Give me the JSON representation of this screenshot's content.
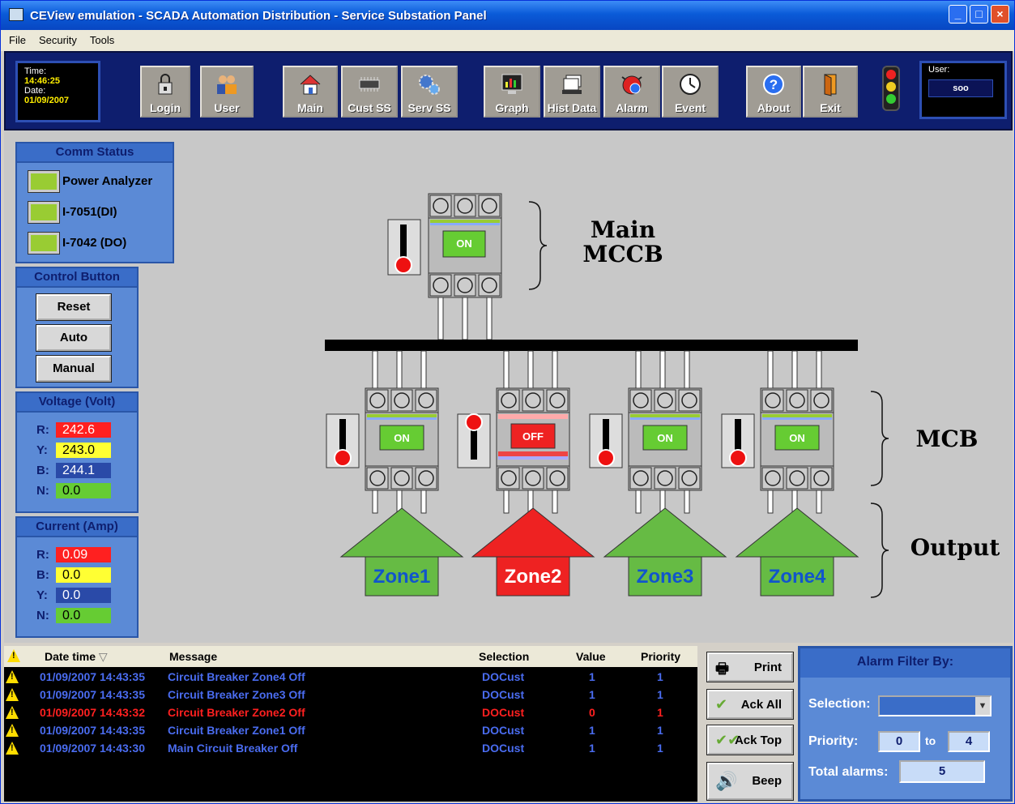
{
  "window": {
    "title": "CEView emulation - SCADA Automation Distribution - Service Substation Panel"
  },
  "menu": [
    "File",
    "Security",
    "Tools"
  ],
  "clock": {
    "time_label": "Time:",
    "time": "14:46:25",
    "date_label": "Date:",
    "date": "01/09/2007"
  },
  "toolbar": {
    "buttons": [
      "Login",
      "User",
      "Main",
      "Cust SS",
      "Serv SS",
      "Graph",
      "Hist Data",
      "Alarm",
      "Event",
      "About",
      "Exit"
    ]
  },
  "user": {
    "label": "User:",
    "value": "soo"
  },
  "comm_status": {
    "title": "Comm Status",
    "items": [
      "Power Analyzer",
      "I-7051(DI)",
      "I-7042 (DO)"
    ],
    "led_color": "#99cc33"
  },
  "control": {
    "title": "Control Button",
    "buttons": [
      "Reset",
      "Auto",
      "Manual"
    ]
  },
  "voltage": {
    "title": "Voltage (Volt)",
    "rows": [
      {
        "k": "R:",
        "v": "242.6",
        "color": "#ff2020",
        "text": "#ffffff"
      },
      {
        "k": "Y:",
        "v": "243.0",
        "color": "#ffff33",
        "text": "#000000"
      },
      {
        "k": "B:",
        "v": "244.1",
        "color": "#2a4aa8",
        "text": "#ffffff"
      },
      {
        "k": "N:",
        "v": "0.0",
        "color": "#66cc33",
        "text": "#000000"
      }
    ]
  },
  "current": {
    "title": "Current (Amp)",
    "rows": [
      {
        "k": "R:",
        "v": "0.09",
        "color": "#ff2020",
        "text": "#ffffff"
      },
      {
        "k": "B:",
        "v": "0.0",
        "color": "#ffff33",
        "text": "#000000"
      },
      {
        "k": "Y:",
        "v": "0.0",
        "color": "#2a4aa8",
        "text": "#ffffff"
      },
      {
        "k": "N:",
        "v": "0.0",
        "color": "#66cc33",
        "text": "#000000"
      }
    ]
  },
  "diagram": {
    "main_label_1": "Main",
    "main_label_2": "MCCB",
    "main_breaker_state": "ON",
    "mcb_label": "MCB",
    "output_label": "Output",
    "zones": [
      {
        "name": "Zone1",
        "state": "ON",
        "color": "#66bb44"
      },
      {
        "name": "Zone2",
        "state": "OFF",
        "color": "#ee2222"
      },
      {
        "name": "Zone3",
        "state": "ON",
        "color": "#66bb44"
      },
      {
        "name": "Zone4",
        "state": "ON",
        "color": "#66bb44"
      }
    ]
  },
  "alarm_log": {
    "headers": {
      "datetime": "Date time",
      "message": "Message",
      "selection": "Selection",
      "value": "Value",
      "priority": "Priority"
    },
    "rows": [
      {
        "datetime": "01/09/2007 14:43:35",
        "message": "Circuit Breaker Zone4 Off",
        "selection": "DOCust",
        "value": "1",
        "priority": "1",
        "color": "#4a6cf0"
      },
      {
        "datetime": "01/09/2007 14:43:35",
        "message": "Circuit Breaker Zone3 Off",
        "selection": "DOCust",
        "value": "1",
        "priority": "1",
        "color": "#4a6cf0"
      },
      {
        "datetime": "01/09/2007 14:43:32",
        "message": "Circuit Breaker Zone2 Off",
        "selection": "DOCust",
        "value": "0",
        "priority": "1",
        "color": "#ff2020"
      },
      {
        "datetime": "01/09/2007 14:43:35",
        "message": "Circuit Breaker Zone1 Off",
        "selection": "DOCust",
        "value": "1",
        "priority": "1",
        "color": "#4a6cf0"
      },
      {
        "datetime": "01/09/2007 14:43:30",
        "message": "Main Circuit Breaker Off",
        "selection": "DOCust",
        "value": "1",
        "priority": "1",
        "color": "#4a6cf0"
      }
    ]
  },
  "side_buttons": [
    "Print",
    "Ack All",
    "Ack Top",
    "Beep"
  ],
  "filter": {
    "title": "Alarm Filter By:",
    "selection_label": "Selection:",
    "selection_value": "",
    "priority_label": "Priority:",
    "priority_from": "0",
    "to_label": "to",
    "priority_to": "4",
    "total_label": "Total alarms:",
    "total": "5"
  }
}
